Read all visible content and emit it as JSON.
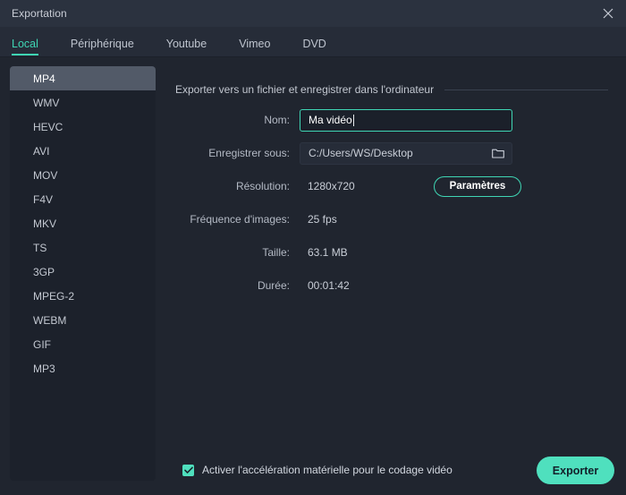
{
  "window": {
    "title": "Exportation",
    "close_icon": "close-icon"
  },
  "tabs": [
    {
      "label": "Local",
      "active": true
    },
    {
      "label": "Périphérique",
      "active": false
    },
    {
      "label": "Youtube",
      "active": false
    },
    {
      "label": "Vimeo",
      "active": false
    },
    {
      "label": "DVD",
      "active": false
    }
  ],
  "sidebar": {
    "items": [
      {
        "label": "MP4",
        "selected": true
      },
      {
        "label": "WMV",
        "selected": false
      },
      {
        "label": "HEVC",
        "selected": false
      },
      {
        "label": "AVI",
        "selected": false
      },
      {
        "label": "MOV",
        "selected": false
      },
      {
        "label": "F4V",
        "selected": false
      },
      {
        "label": "MKV",
        "selected": false
      },
      {
        "label": "TS",
        "selected": false
      },
      {
        "label": "3GP",
        "selected": false
      },
      {
        "label": "MPEG-2",
        "selected": false
      },
      {
        "label": "WEBM",
        "selected": false
      },
      {
        "label": "GIF",
        "selected": false
      },
      {
        "label": "MP3",
        "selected": false
      }
    ]
  },
  "main": {
    "section_title": "Exporter vers un fichier et enregistrer dans l'ordinateur",
    "name": {
      "label": "Nom:",
      "value": "Ma vidéo",
      "placeholder": "Ma vidéo"
    },
    "save_to": {
      "label": "Enregistrer sous:",
      "value": "C:/Users/WS/Desktop",
      "browse_icon": "folder-icon"
    },
    "resolution": {
      "label": "Résolution:",
      "value": "1280x720"
    },
    "settings_button": "Paramètres",
    "frame_rate": {
      "label": "Fréquence d'images:",
      "value": "25 fps"
    },
    "size": {
      "label": "Taille:",
      "value": "63.1 MB"
    },
    "duration": {
      "label": "Durée:",
      "value": "00:01:42"
    }
  },
  "footer": {
    "hardware_acceleration_label": "Activer l'accélération matérielle pour le codage vidéo",
    "hardware_acceleration_checked": true,
    "export_button": "Exporter"
  },
  "colors": {
    "accent": "#3fd6b4",
    "accent_solid": "#4fe0be",
    "background": "#20252f",
    "panel": "#1c212b",
    "titlebar": "#2b323f",
    "selected_row": "#525a68"
  }
}
